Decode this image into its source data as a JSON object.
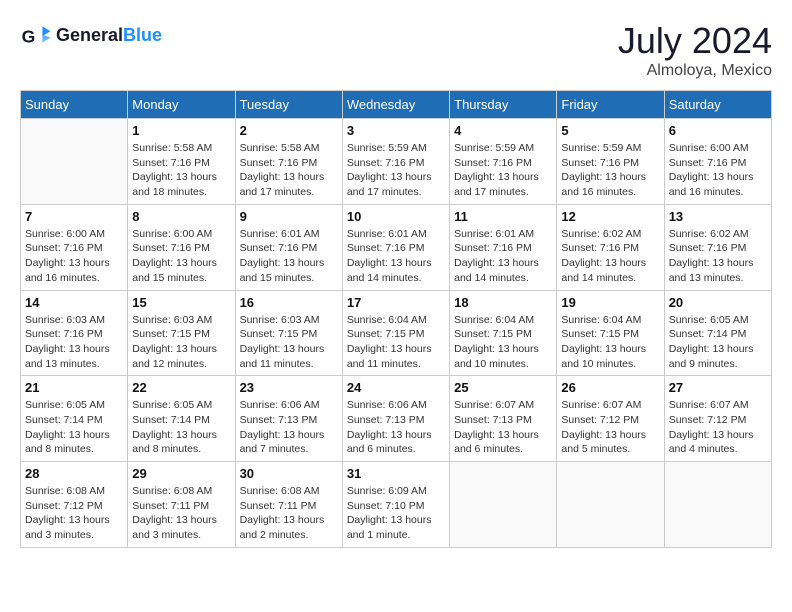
{
  "header": {
    "logo_text_general": "General",
    "logo_text_blue": "Blue",
    "month_title": "July 2024",
    "subtitle": "Almoloya, Mexico"
  },
  "weekdays": [
    "Sunday",
    "Monday",
    "Tuesday",
    "Wednesday",
    "Thursday",
    "Friday",
    "Saturday"
  ],
  "weeks": [
    [
      {
        "day": "",
        "info": ""
      },
      {
        "day": "1",
        "info": "Sunrise: 5:58 AM\nSunset: 7:16 PM\nDaylight: 13 hours\nand 18 minutes."
      },
      {
        "day": "2",
        "info": "Sunrise: 5:58 AM\nSunset: 7:16 PM\nDaylight: 13 hours\nand 17 minutes."
      },
      {
        "day": "3",
        "info": "Sunrise: 5:59 AM\nSunset: 7:16 PM\nDaylight: 13 hours\nand 17 minutes."
      },
      {
        "day": "4",
        "info": "Sunrise: 5:59 AM\nSunset: 7:16 PM\nDaylight: 13 hours\nand 17 minutes."
      },
      {
        "day": "5",
        "info": "Sunrise: 5:59 AM\nSunset: 7:16 PM\nDaylight: 13 hours\nand 16 minutes."
      },
      {
        "day": "6",
        "info": "Sunrise: 6:00 AM\nSunset: 7:16 PM\nDaylight: 13 hours\nand 16 minutes."
      }
    ],
    [
      {
        "day": "7",
        "info": ""
      },
      {
        "day": "8",
        "info": "Sunrise: 6:00 AM\nSunset: 7:16 PM\nDaylight: 13 hours\nand 15 minutes."
      },
      {
        "day": "9",
        "info": "Sunrise: 6:01 AM\nSunset: 7:16 PM\nDaylight: 13 hours\nand 15 minutes."
      },
      {
        "day": "10",
        "info": "Sunrise: 6:01 AM\nSunset: 7:16 PM\nDaylight: 13 hours\nand 14 minutes."
      },
      {
        "day": "11",
        "info": "Sunrise: 6:01 AM\nSunset: 7:16 PM\nDaylight: 13 hours\nand 14 minutes."
      },
      {
        "day": "12",
        "info": "Sunrise: 6:02 AM\nSunset: 7:16 PM\nDaylight: 13 hours\nand 14 minutes."
      },
      {
        "day": "13",
        "info": "Sunrise: 6:02 AM\nSunset: 7:16 PM\nDaylight: 13 hours\nand 13 minutes."
      }
    ],
    [
      {
        "day": "14",
        "info": ""
      },
      {
        "day": "15",
        "info": "Sunrise: 6:03 AM\nSunset: 7:15 PM\nDaylight: 13 hours\nand 12 minutes."
      },
      {
        "day": "16",
        "info": "Sunrise: 6:03 AM\nSunset: 7:15 PM\nDaylight: 13 hours\nand 11 minutes."
      },
      {
        "day": "17",
        "info": "Sunrise: 6:04 AM\nSunset: 7:15 PM\nDaylight: 13 hours\nand 11 minutes."
      },
      {
        "day": "18",
        "info": "Sunrise: 6:04 AM\nSunset: 7:15 PM\nDaylight: 13 hours\nand 10 minutes."
      },
      {
        "day": "19",
        "info": "Sunrise: 6:04 AM\nSunset: 7:15 PM\nDaylight: 13 hours\nand 10 minutes."
      },
      {
        "day": "20",
        "info": "Sunrise: 6:05 AM\nSunset: 7:14 PM\nDaylight: 13 hours\nand 9 minutes."
      }
    ],
    [
      {
        "day": "21",
        "info": ""
      },
      {
        "day": "22",
        "info": "Sunrise: 6:05 AM\nSunset: 7:14 PM\nDaylight: 13 hours\nand 8 minutes."
      },
      {
        "day": "23",
        "info": "Sunrise: 6:06 AM\nSunset: 7:13 PM\nDaylight: 13 hours\nand 7 minutes."
      },
      {
        "day": "24",
        "info": "Sunrise: 6:06 AM\nSunset: 7:13 PM\nDaylight: 13 hours\nand 6 minutes."
      },
      {
        "day": "25",
        "info": "Sunrise: 6:07 AM\nSunset: 7:13 PM\nDaylight: 13 hours\nand 6 minutes."
      },
      {
        "day": "26",
        "info": "Sunrise: 6:07 AM\nSunset: 7:12 PM\nDaylight: 13 hours\nand 5 minutes."
      },
      {
        "day": "27",
        "info": "Sunrise: 6:07 AM\nSunset: 7:12 PM\nDaylight: 13 hours\nand 4 minutes."
      }
    ],
    [
      {
        "day": "28",
        "info": "Sunrise: 6:08 AM\nSunset: 7:12 PM\nDaylight: 13 hours\nand 3 minutes."
      },
      {
        "day": "29",
        "info": "Sunrise: 6:08 AM\nSunset: 7:11 PM\nDaylight: 13 hours\nand 3 minutes."
      },
      {
        "day": "30",
        "info": "Sunrise: 6:08 AM\nSunset: 7:11 PM\nDaylight: 13 hours\nand 2 minutes."
      },
      {
        "day": "31",
        "info": "Sunrise: 6:09 AM\nSunset: 7:10 PM\nDaylight: 13 hours\nand 1 minute."
      },
      {
        "day": "",
        "info": ""
      },
      {
        "day": "",
        "info": ""
      },
      {
        "day": "",
        "info": ""
      }
    ]
  ],
  "week7_day7_info": "Sunrise: 6:00 AM\nSunset: 7:16 PM\nDaylight: 13 hours\nand 16 minutes.",
  "week14_day14_info": "Sunrise: 6:03 AM\nSunset: 7:16 PM\nDaylight: 13 hours\nand 13 minutes.",
  "week21_day21_info": "Sunrise: 6:05 AM\nSunset: 7:14 PM\nDaylight: 13 hours\nand 8 minutes."
}
